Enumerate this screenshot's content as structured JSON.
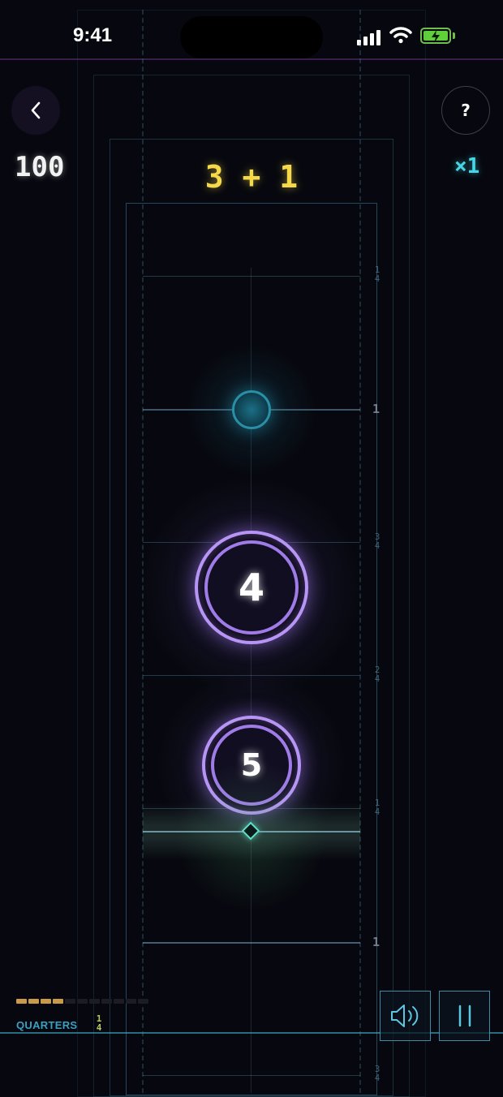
{
  "status_bar": {
    "time": "9:41"
  },
  "header": {
    "score": "100",
    "problem": "3 + 1",
    "multiplier": "×1",
    "help_label": "?"
  },
  "orbs": [
    {
      "label": "4"
    },
    {
      "label": "5"
    }
  ],
  "track_markers": {
    "quarter": {
      "num": "1",
      "den": "4"
    },
    "half": {
      "num": "2",
      "den": "4"
    },
    "three_quarter": {
      "num": "3",
      "den": "4"
    },
    "whole": "1"
  },
  "bottom": {
    "mode_label": "QUARTERS",
    "mode_fraction": {
      "num": "1",
      "den": "4"
    },
    "progress_filled": 4,
    "progress_total": 11,
    "progress_color": "#c99a4a"
  },
  "colors": {
    "background": "#07080f",
    "accent_cyan": "#46d6e6",
    "problem_yellow": "#f5d94a",
    "orb_purple": "#b795f5",
    "hit_marker": "#5fe0c8"
  },
  "icons": {
    "back": "chevron-left-icon",
    "help": "question-icon",
    "sound": "speaker-icon",
    "pause": "pause-icon"
  }
}
